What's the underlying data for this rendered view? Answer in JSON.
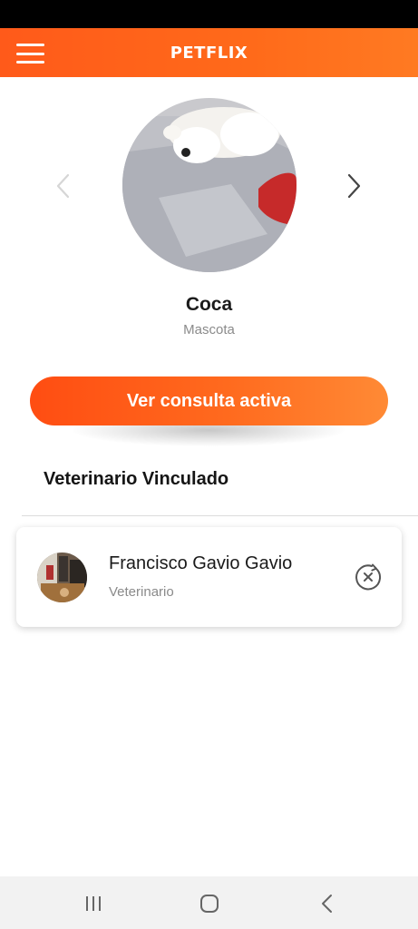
{
  "app": {
    "logo_text": "PETFLIX",
    "brand_color": "#ff5a1a"
  },
  "header": {
    "menu_icon": "hamburger-menu-icon"
  },
  "pet": {
    "name": "Coca",
    "role": "Mascota",
    "prev_icon": "chevron-left-icon",
    "next_icon": "chevron-right-icon"
  },
  "actions": {
    "active_consultation_label": "Ver consulta activa"
  },
  "vet_section": {
    "title": "Veterinario Vinculado",
    "vet": {
      "name": "Francisco Gavio Gavio",
      "role": "Veterinario",
      "unlink_icon": "unlink-x-circle-icon"
    }
  },
  "system_nav": {
    "recents_icon": "recents-icon",
    "home_icon": "home-icon",
    "back_icon": "back-icon"
  }
}
